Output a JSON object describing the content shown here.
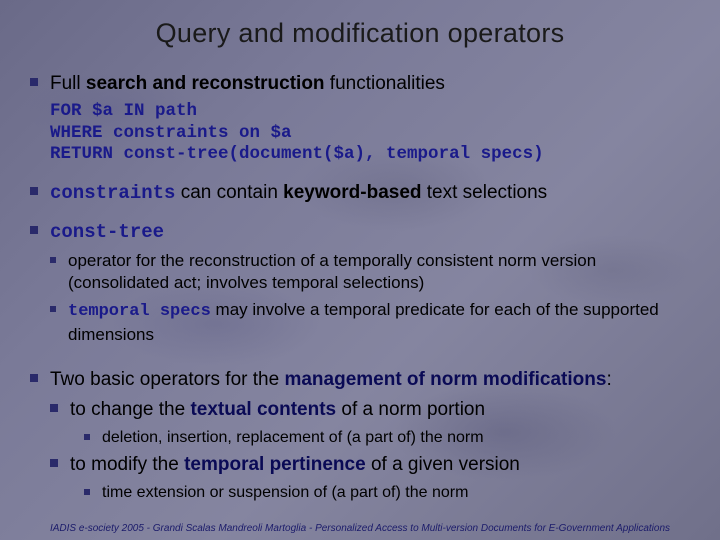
{
  "title": "Query and modification operators",
  "b1": {
    "pre": "Full ",
    "bold": "search and reconstruction",
    "post": " functionalities"
  },
  "code": "FOR $a IN path\nWHERE constraints on $a\nRETURN const-tree(document($a), temporal specs)",
  "b2": {
    "code": "constraints",
    "mid": " can contain ",
    "bold": "keyword-based",
    "post": " text selections"
  },
  "b3": {
    "code": "const-tree"
  },
  "b3a": "operator for the reconstruction of a temporally consistent norm version (consolidated act; involves temporal selections)",
  "b3b": {
    "code": "temporal specs",
    "post": " may involve a temporal predicate for each of the supported dimensions"
  },
  "b4": {
    "pre": "Two basic operators for the ",
    "bold": "management of norm modifications",
    "post": ":"
  },
  "b4a": {
    "pre": "to change the ",
    "bold": "textual contents",
    "post": " of a norm portion"
  },
  "b4a1": "deletion, insertion, replacement of (a part of) the norm",
  "b4b": {
    "pre": "to modify the ",
    "bold": "temporal pertinence",
    "post": " of a given version"
  },
  "b4b1": "time extension or suspension of (a part of) the norm",
  "footer": "IADIS e-society 2005  -  Grandi  Scalas  Mandreoli  Martoglia  -  Personalized Access to Multi-version Documents for E-Government Applications"
}
